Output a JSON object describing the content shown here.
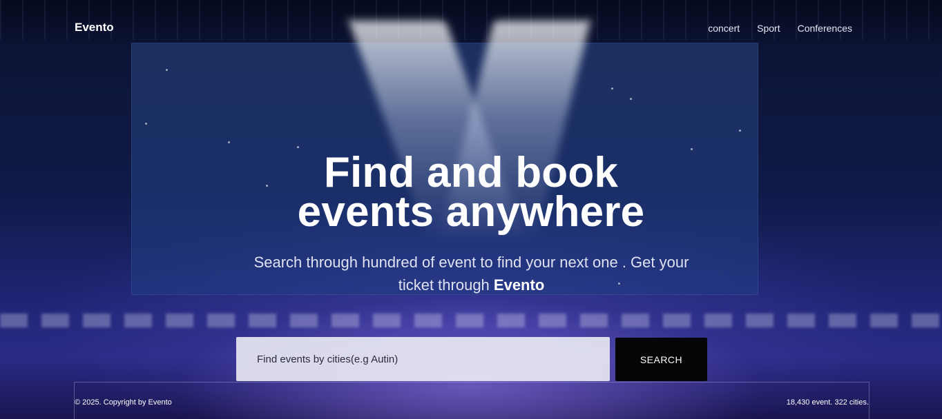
{
  "header": {
    "brand": "Evento",
    "nav": [
      "concert",
      "Sport",
      "Conferences"
    ]
  },
  "hero": {
    "headline_line1": "Find and book",
    "headline_line2": "events anywhere",
    "subtitle_pre": "Search through hundred of event to find your next one . Get your ticket through ",
    "subtitle_brand": "Evento"
  },
  "search": {
    "placeholder": "Find events by cities(e.g Autin)",
    "button_label": "SEARCH"
  },
  "footer": {
    "copyright": "© 2025. Copyright by Evento",
    "stats": "18,430 event. 322 cities."
  }
}
